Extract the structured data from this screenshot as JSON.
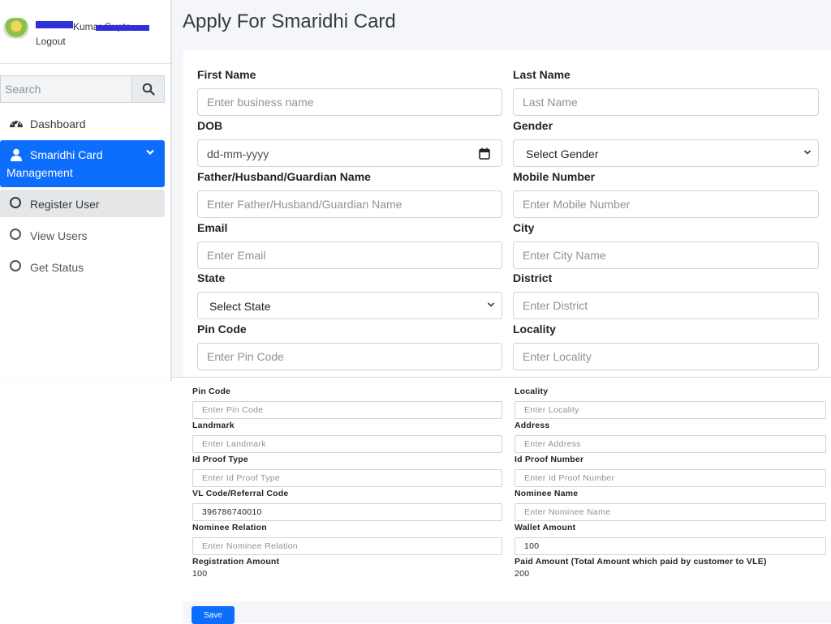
{
  "sidebar": {
    "user_name": "Kumar Gupta",
    "logout": "Logout",
    "search_placeholder": "Search",
    "items": [
      {
        "label": "Dashboard",
        "icon": "tachometer-icon"
      },
      {
        "label": "Smaridhi Card",
        "label2": "Management",
        "icon": "user-icon"
      },
      {
        "label": "Register User",
        "icon": "circle-icon"
      },
      {
        "label": "View Users",
        "icon": "circle-icon"
      },
      {
        "label": "Get Status",
        "icon": "circle-icon"
      }
    ]
  },
  "page": {
    "title": "Apply For Smaridhi Card"
  },
  "form_top": {
    "first_name": {
      "label": "First Name",
      "placeholder": "Enter business name"
    },
    "last_name": {
      "label": "Last Name",
      "placeholder": "Last Name"
    },
    "dob": {
      "label": "DOB",
      "placeholder": "dd-mm-yyyy"
    },
    "gender": {
      "label": "Gender",
      "value": "Select Gender"
    },
    "guardian": {
      "label": "Father/Husband/Guardian Name",
      "placeholder": "Enter Father/Husband/Guardian Name"
    },
    "mobile": {
      "label": "Mobile Number",
      "placeholder": "Enter Mobile Number"
    },
    "email": {
      "label": "Email",
      "placeholder": "Enter Email"
    },
    "city": {
      "label": "City",
      "placeholder": "Enter City Name"
    },
    "state": {
      "label": "State",
      "value": "Select State"
    },
    "district": {
      "label": "District",
      "placeholder": "Enter District"
    },
    "pin": {
      "label": "Pin Code",
      "placeholder": "Enter Pin Code"
    },
    "locality": {
      "label": "Locality",
      "placeholder": "Enter Locality"
    }
  },
  "form_bottom": {
    "pin": {
      "label": "Pin Code",
      "placeholder": "Enter Pin Code"
    },
    "locality": {
      "label": "Locality",
      "placeholder": "Enter Locality"
    },
    "landmark": {
      "label": "Landmark",
      "placeholder": "Enter Landmark"
    },
    "address": {
      "label": "Address",
      "placeholder": "Enter Address"
    },
    "id_type": {
      "label": "Id Proof Type",
      "placeholder": "Enter Id Proof Type"
    },
    "id_number": {
      "label": "Id Proof Number",
      "placeholder": "Enter Id Proof Number"
    },
    "vl_code": {
      "label": "VL Code/Referral Code",
      "value": "396786740010"
    },
    "nominee_name": {
      "label": "Nominee Name",
      "placeholder": "Enter Nominee Name"
    },
    "nominee_relation": {
      "label": "Nominee Relation",
      "placeholder": "Enter Nominee Relation"
    },
    "wallet": {
      "label": "Wallet Amount",
      "value": "100"
    },
    "registration_amount": {
      "label": "Registration Amount",
      "value": "100"
    },
    "paid_amount": {
      "label": "Paid Amount (Total Amount which paid by customer to VLE)",
      "value": "200"
    },
    "save": "Save"
  },
  "colors": {
    "primary": "#0d6efd",
    "redaction": "#2e31d9",
    "content_bg": "#f4f6f9"
  }
}
